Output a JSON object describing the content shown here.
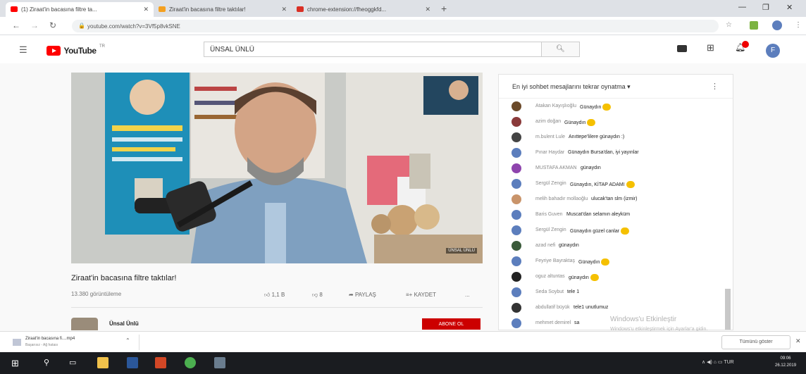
{
  "browser": {
    "tabs": [
      {
        "label": "(1) Ziraat'in bacasına filtre ta...",
        "active": true,
        "favicon_color": "#ff0000"
      },
      {
        "label": "Ziraat'in bacasına filtre taktılar!",
        "active": false,
        "favicon_color": "#f4a020"
      },
      {
        "label": "chrome-extension://fheoggkfd...",
        "active": false,
        "favicon_color": "#d93025"
      }
    ],
    "url": "youtube.com/watch?v=3Vf5p8vkSNE"
  },
  "youtube": {
    "logo_text": "YouTube",
    "logo_tm": "TR",
    "search_value": "ÜNSAL ÜNLÜ",
    "avatar_letter": "F"
  },
  "video": {
    "title": "Ziraat'in bacasına filtre taktılar!",
    "views": "13.380 görüntüleme",
    "likes": "1,1 B",
    "dislikes": "8",
    "share_label": "PAYLAŞ",
    "save_label": "KAYDET",
    "more_label": "...",
    "watermark": "ÜNSAL ÜNLÜ",
    "channel_name": "Ünsal Ünlü",
    "subscribe_label": "ABONE OL"
  },
  "chat": {
    "header": "En iyi sohbet mesajlarını tekrar oynatma",
    "messages": [
      {
        "author": "Atakan Kayışlıoğlu",
        "text": "Günaydın",
        "emoji": true,
        "avatar_color": "#6b4a2a"
      },
      {
        "author": "azim doğan",
        "text": "Günaydın",
        "emoji": true,
        "avatar_color": "#8a3a3a"
      },
      {
        "author": "m.bulent Lule",
        "text": "Anıttepe'lilere günaydın :)",
        "emoji": false,
        "avatar_color": "#444444"
      },
      {
        "author": "Pınar Haydar",
        "text": "Günaydın Bursa'dan, iyi yayınlar",
        "emoji": false,
        "avatar_color": "#5c7ebd"
      },
      {
        "author": "MUSTAFA AKMAN",
        "text": "günaydın",
        "emoji": false,
        "avatar_color": "#8e44ad"
      },
      {
        "author": "Sergül Zengin",
        "text": "Günaydın, KİTAP ADAMI",
        "emoji": true,
        "avatar_color": "#5c7ebd"
      },
      {
        "author": "melih bahadır mollaoğlu",
        "text": "ulucak'tan slm (izmir)",
        "emoji": false,
        "avatar_color": "#c9946a"
      },
      {
        "author": "Baris Guven",
        "text": "Muscat'dan selamın aleyküm",
        "emoji": false,
        "avatar_color": "#5c7ebd"
      },
      {
        "author": "Sergül Zengin",
        "text": "Günaydın güzel canlar",
        "emoji": true,
        "avatar_color": "#5c7ebd"
      },
      {
        "author": "azad nefi",
        "text": "günaydın",
        "emoji": false,
        "avatar_color": "#3a5a3a"
      },
      {
        "author": "Feyriye Bayraktaş",
        "text": "Günaydın",
        "emoji": true,
        "avatar_color": "#5c7ebd"
      },
      {
        "author": "oguz altuntas",
        "text": "günaydın",
        "emoji": true,
        "avatar_color": "#222222"
      },
      {
        "author": "Seda Soybut",
        "text": "tele 1",
        "emoji": false,
        "avatar_color": "#5c7ebd"
      },
      {
        "author": "abdullatif büyük",
        "text": "tele1 unutlumuz",
        "emoji": false,
        "avatar_color": "#333333"
      },
      {
        "author": "mehmet demirel",
        "text": "sa",
        "emoji": false,
        "avatar_color": "#5c7ebd"
      }
    ]
  },
  "windows_watermark": {
    "line1": "Windows'u Etkinleştir",
    "line2": "Windows'u etkinleştirmek için Ayarlar'a gidin."
  },
  "download_shelf": {
    "filename": "Ziraat'in bacasına fi....mp4",
    "status": "Başarısız - Ağ hatası",
    "show_all": "Tümünü göster"
  },
  "taskbar": {
    "tray_text": "∧  ◀)  ⌂  ▭  TUR",
    "time": "09:06",
    "date": "26.12.2019"
  }
}
